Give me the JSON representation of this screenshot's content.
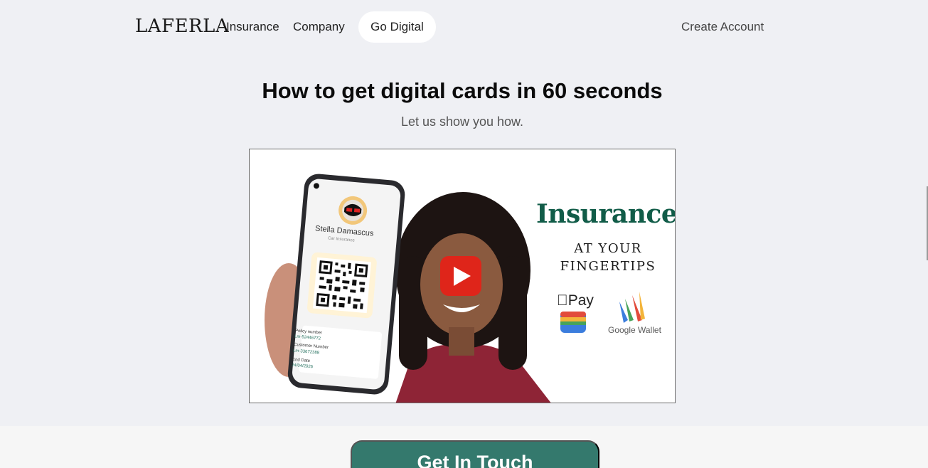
{
  "nav": {
    "logo": "LAFERLA",
    "links": [
      "Insurance",
      "Company"
    ],
    "highlight_link": "Go Digital",
    "account": "Create Account"
  },
  "hero": {
    "title": "How to get digital cards in 60 seconds",
    "subtitle": "Let us show you how."
  },
  "video": {
    "heading": "Insurance",
    "tagline_1": "AT YOUR",
    "tagline_2": "FINGERTIPS",
    "apple_pay": "Pay",
    "google_wallet": "Google Wallet",
    "card_name": "Stella Damascus",
    "card_type": "Car Insurance",
    "fields": [
      {
        "label": "Policy number",
        "value": "Lm-52446772"
      },
      {
        "label": "Customer Number",
        "value": "Lm-33672388"
      },
      {
        "label": "End Date",
        "value": "24/04/2026"
      }
    ],
    "play_icon": "play-icon",
    "colors": {
      "brand_green": "#115c48",
      "play_red": "#e62117"
    }
  },
  "cta": {
    "label": "Get In Touch",
    "color": "#34796d"
  }
}
